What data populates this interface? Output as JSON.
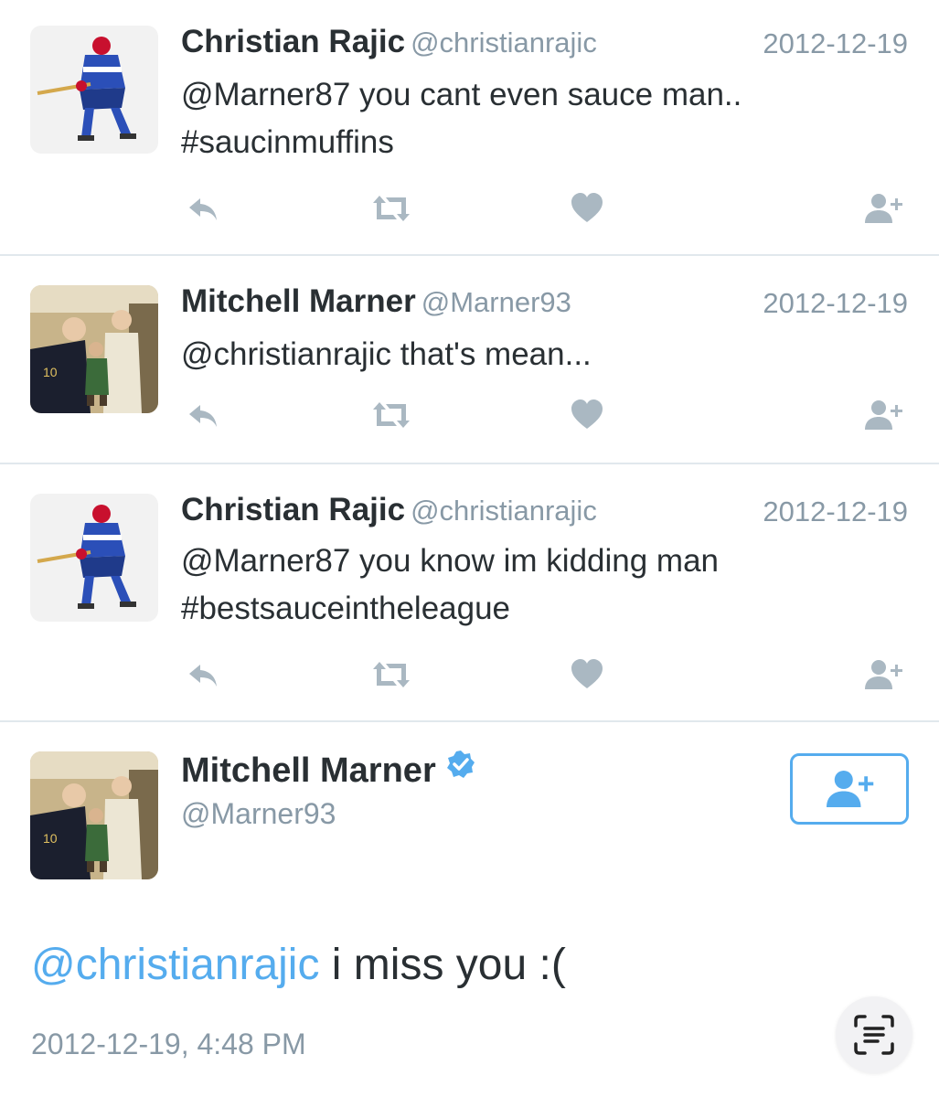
{
  "tweets": [
    {
      "name": "Christian Rajic",
      "handle": "@christianrajic",
      "date": "2012-12-19",
      "line1": "@Marner87 you cant even sauce man..",
      "line2": "#saucinmuffins",
      "avatar": "hockey-player-avatar"
    },
    {
      "name": "Mitchell Marner",
      "handle": "@Marner93",
      "date": "2012-12-19",
      "line1": "@christianrajic that's mean...",
      "line2": "",
      "avatar": "group-photo-avatar"
    },
    {
      "name": "Christian Rajic",
      "handle": "@christianrajic",
      "date": "2012-12-19",
      "line1": "@Marner87 you know im kidding man",
      "line2": "#bestsauceintheleague",
      "avatar": "hockey-player-avatar"
    }
  ],
  "main_tweet": {
    "name": "Mitchell Marner",
    "handle": "@Marner93",
    "verified": true,
    "mention": "@christianrajic",
    "text": " i miss you :(",
    "timestamp": "2012-12-19, 4:48 PM"
  },
  "icons": {
    "reply": "reply-icon",
    "retweet": "retweet-icon",
    "like": "heart-icon",
    "follow": "follow-icon",
    "scan": "scan-text-icon"
  },
  "colors": {
    "accent": "#55acee",
    "icon_gray": "#aab8c2",
    "text": "#292f33",
    "muted": "#8899a6"
  }
}
